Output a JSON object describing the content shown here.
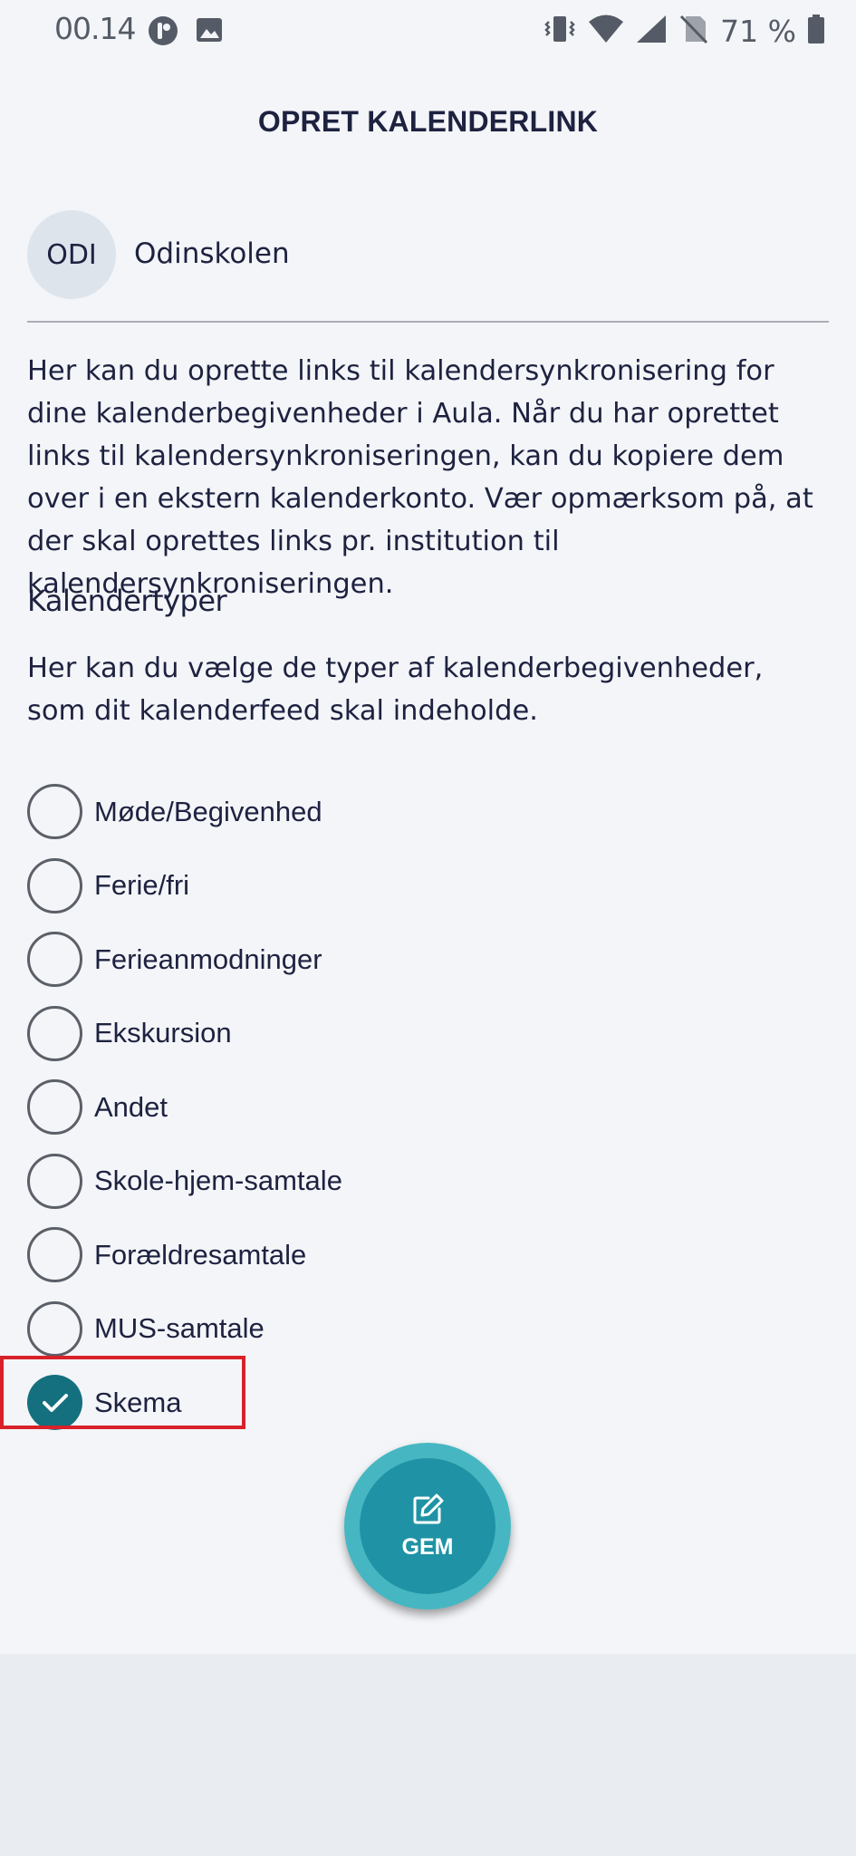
{
  "status_bar": {
    "time": "00.14",
    "battery": "71 %"
  },
  "header": {
    "title": "OPRET KALENDERLINK"
  },
  "institution": {
    "initials": "ODI",
    "name": "Odinskolen"
  },
  "intro_text": "Her kan du oprette links til kalendersynkronisering for dine kalenderbegivenheder i Aula. Når du har oprettet links til kalendersynkroniseringen, kan du kopiere dem over i en ekstern kalenderkonto. Vær opmærksom på, at der skal oprettes links pr. institution til kalendersynkroniseringen.",
  "calendar_types": {
    "title": "Kalendertyper",
    "description": "Her kan du vælge de typer af kalenderbegivenheder, som dit kalenderfeed skal indeholde.",
    "options": [
      {
        "label": "Møde/Begivenhed",
        "checked": false
      },
      {
        "label": "Ferie/fri",
        "checked": false
      },
      {
        "label": "Ferieanmodninger",
        "checked": false
      },
      {
        "label": "Ekskursion",
        "checked": false
      },
      {
        "label": "Andet",
        "checked": false
      },
      {
        "label": "Skole-hjem-samtale",
        "checked": false
      },
      {
        "label": "Forældresamtale",
        "checked": false
      },
      {
        "label": "MUS-samtale",
        "checked": false
      },
      {
        "label": "Skema",
        "checked": true
      }
    ]
  },
  "save_button": {
    "label": "GEM",
    "icon": "edit-icon"
  },
  "colors": {
    "accent": "#1f93a5",
    "accent_light": "#46b7c2",
    "checked": "#14707f",
    "text": "#1e2240",
    "highlight": "#d9212a"
  }
}
